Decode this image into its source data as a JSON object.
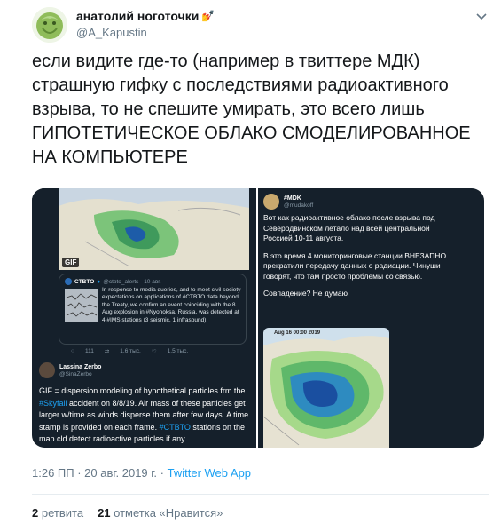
{
  "author": {
    "display_name": "анатолий ноготочки",
    "emoji": "💅",
    "handle": "@A_Kapustin"
  },
  "tweet_text": {
    "line1": "если видите где-то (например в твиттере МДК)",
    "line2": "страшную гифку с последствиями радиоактивного",
    "line3": "взрыва, то не спешите умирать, это всего лишь",
    "line4": "ГИПОТЕТИЧЕСКОЕ ОБЛАКО СМОДЕЛИРОВАННОЕ",
    "line5": "НА КОМПЬЮТЕРЕ"
  },
  "media_left": {
    "gif_badge": "GIF",
    "quote": {
      "name": "CTBTO",
      "meta": "@ctbto_alerts · 10 авг.",
      "body": "In response to media queries, and to meet civil society expectations on applications of #CTBTO data beyond the Treaty, we confirm an event coinciding with the 8 Aug explosion in #Nyonoksa, Russia, was detected at 4 #IMS stations (3 seismic, 1 infrasound)."
    },
    "actions": {
      "reply": "111",
      "retweet": "1,6 тыс.",
      "like": "1,5 тыс."
    },
    "reply_author": {
      "name": "Lassina Zerbo",
      "handle": "@SinaZerbo"
    },
    "body": {
      "part1": "GIF = dispersion modeling of hypothetical particles frm the ",
      "hashtag1": "#Skyfall",
      "part2": " accident on 8/8/19. Air mass of these particles get larger w/time as winds disperse them after few days. A time stamp is provided on each frame. ",
      "hashtag2": "#CTBTO",
      "part3": " stations on the map cld detect radioactive particles if any"
    }
  },
  "media_right": {
    "name": "#MDK",
    "handle": "@mudakoff",
    "para1_line1": "Вот как радиоактивное облако после взрыва под",
    "para1_line2": "Северодвинском летало над всей центральной",
    "para1_line3": "Россией 10-11 августа.",
    "para2_line1": "В это время 4 мониторинговые станции ВНЕЗАПНО",
    "para2_line2": "прекратили передачу данных о радиации. Чинуши",
    "para2_line3": "говорят, что там просто проблемы со связью.",
    "para3": "Совпадение? Не думаю",
    "map_stamp": "Aug 16 00:00 2019"
  },
  "meta": {
    "time_date": "1:26 ПП · 20 авг. 2019 г. · ",
    "source": "Twitter Web App"
  },
  "stats": {
    "retweets_count": "2",
    "retweets_label": "ретвита",
    "likes_count": "21",
    "likes_label": "отметка «Нравится»"
  },
  "colors": {
    "link": "#1da1f2",
    "dark_bg": "#15202b",
    "muted": "#657786"
  }
}
